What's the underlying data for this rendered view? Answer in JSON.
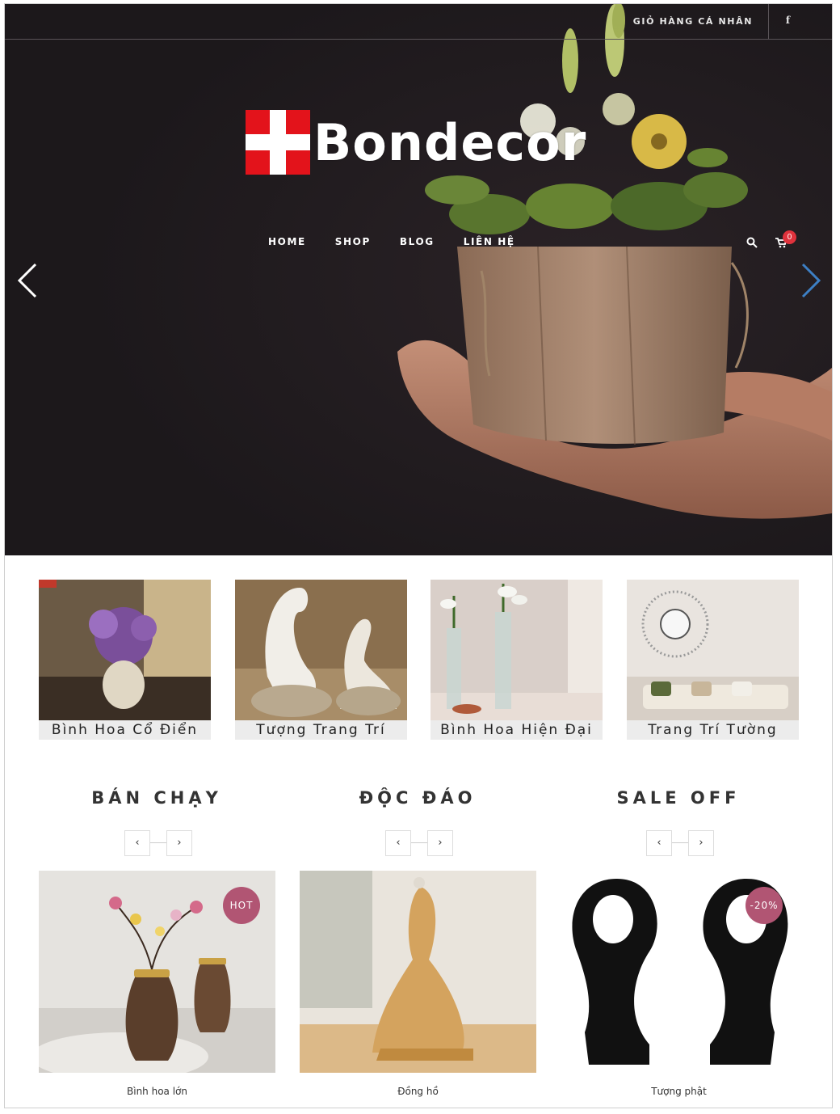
{
  "topbar": {
    "cart_link": "GIỎ HÀNG CÁ NHÂN",
    "facebook_icon": "f"
  },
  "brand": {
    "logo_text": "Bondecor",
    "accent": "#e3131b"
  },
  "nav": {
    "items": [
      "HOME",
      "SHOP",
      "BLOG",
      "LIÊN HỆ"
    ],
    "cart_count": "0"
  },
  "icons": {
    "search": "search-icon",
    "cart": "cart-icon",
    "prev": "chevron-left-icon",
    "next": "chevron-right-icon"
  },
  "categories": [
    {
      "label": "Bình Hoa Cổ Điển"
    },
    {
      "label": "Tượng Trang Trí"
    },
    {
      "label": "Bình Hoa Hiện Đại"
    },
    {
      "label": "Trang Trí Tường"
    }
  ],
  "sections": [
    {
      "title": "BÁN CHẠY",
      "prev": "‹",
      "next": "›",
      "product": {
        "name": "Bình hoa lớn",
        "badge": "HOT"
      }
    },
    {
      "title": "ĐỘC ĐÁO",
      "prev": "‹",
      "next": "›",
      "product": {
        "name": "Đồng hồ",
        "badge": ""
      }
    },
    {
      "title": "SALE OFF",
      "prev": "‹",
      "next": "›",
      "product": {
        "name": "Tượng phật",
        "badge": "-20%"
      }
    }
  ],
  "colors": {
    "hero_bg": "#1f1a1e",
    "badge": "#b15573",
    "cart_badge": "#e0323c",
    "arrow_right": "#3d7fc4"
  }
}
